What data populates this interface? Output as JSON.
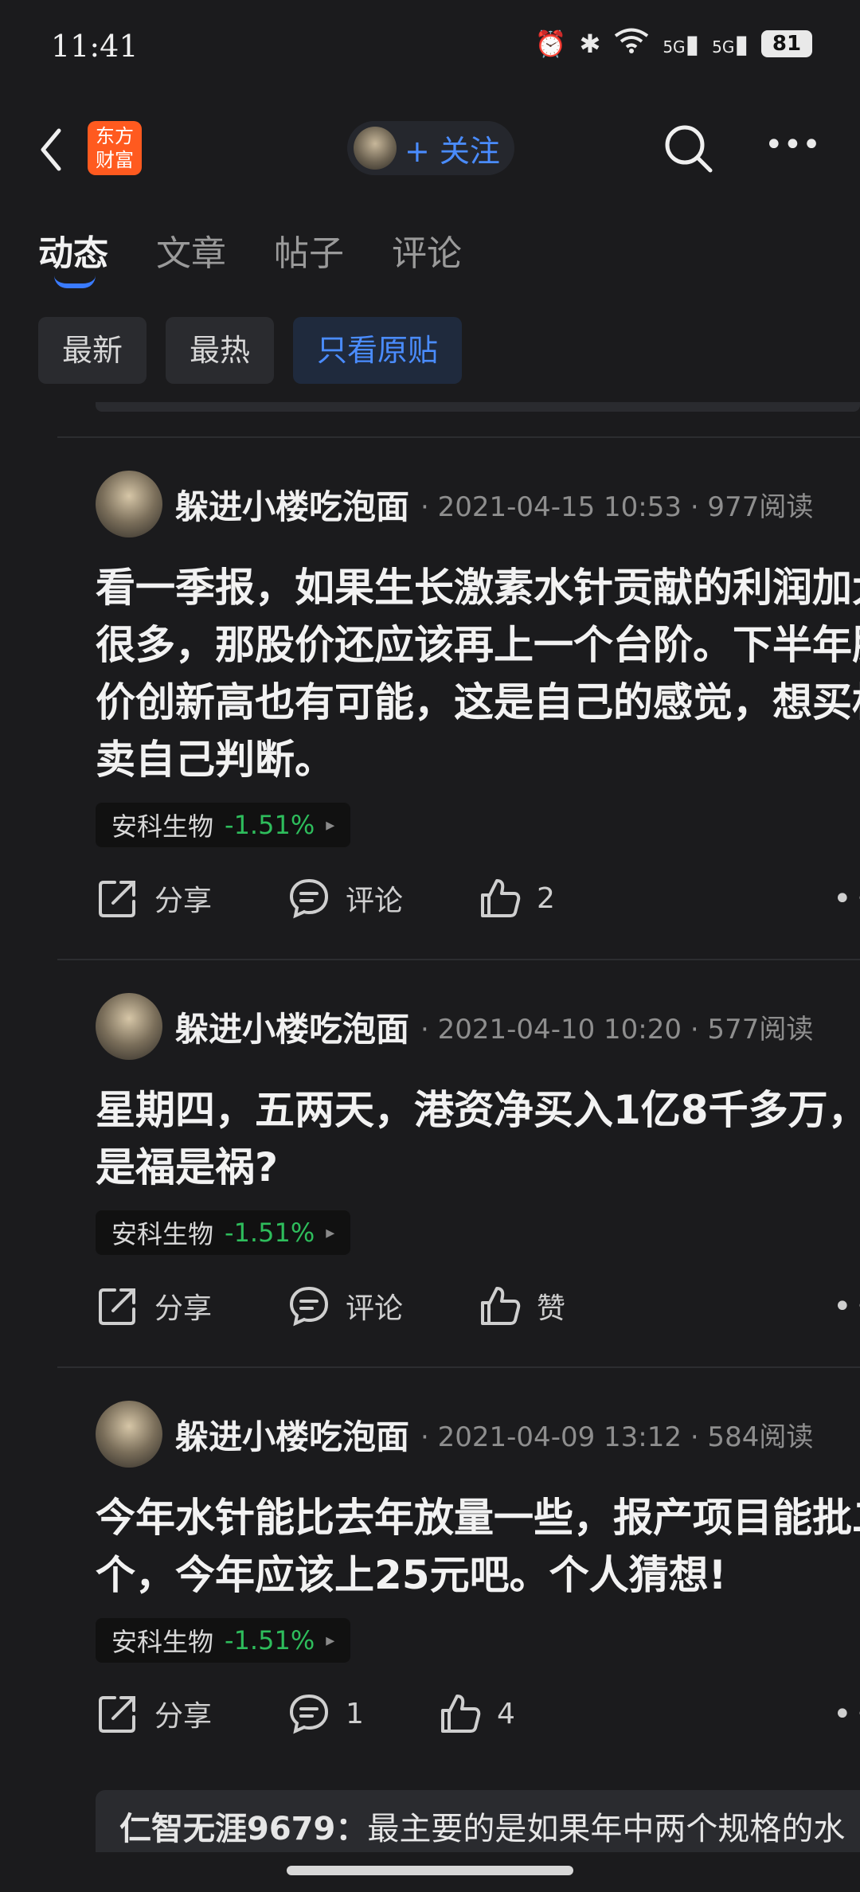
{
  "status": {
    "time": "11:41",
    "battery": "81",
    "net1": "5G",
    "net2": "5G"
  },
  "header": {
    "logo_line1": "东方",
    "logo_line2": "财富",
    "follow_label": "+ 关注"
  },
  "tabs": [
    {
      "label": "动态"
    },
    {
      "label": "文章"
    },
    {
      "label": "帖子"
    },
    {
      "label": "评论"
    }
  ],
  "filters": [
    {
      "label": "最新"
    },
    {
      "label": "最热"
    },
    {
      "label": "只看原贴"
    }
  ],
  "posts": [
    {
      "author": "躲进小楼吃泡面",
      "meta": "· 2021-04-15 10:53 · 977阅读",
      "body": "看一季报，如果生长激素水针贡献的利润加大很多，那股价还应该再上一个台阶。下半年股价创新高也有可能，这是自己的感觉，想买相卖自己判断。",
      "stock_name": "安科生物",
      "stock_change": "-1.51%",
      "share": "分享",
      "comment": "评论",
      "like": "2"
    },
    {
      "author": "躲进小楼吃泡面",
      "meta": "· 2021-04-10 10:20 · 577阅读",
      "body": "星期四，五两天，港资净买入1亿8千多万，是福是祸?",
      "stock_name": "安科生物",
      "stock_change": "-1.51%",
      "share": "分享",
      "comment": "评论",
      "like": "赞"
    },
    {
      "author": "躲进小楼吃泡面",
      "meta": "· 2021-04-09 13:12 · 584阅读",
      "body": "今年水针能比去年放量一些，报产项目能批二个，今年应该上25元吧。个人猜想!",
      "stock_name": "安科生物",
      "stock_change": "-1.51%",
      "share": "分享",
      "comment": "1",
      "like": "4"
    }
  ],
  "reply": {
    "name": "仁智无涯9679：",
    "text": "最主要的是如果年中两个规格的水"
  }
}
